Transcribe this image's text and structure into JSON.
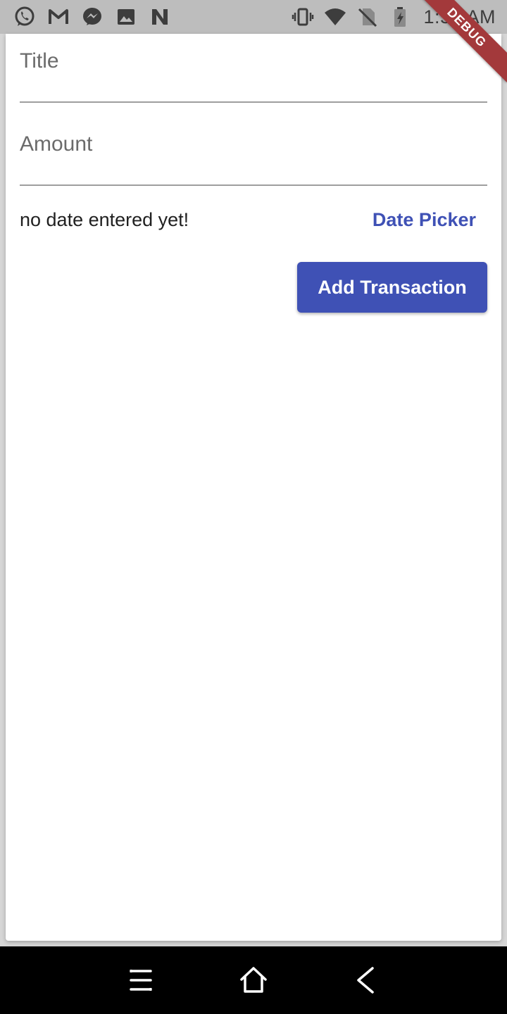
{
  "status_bar": {
    "time": "1:54 AM",
    "left_icons": [
      "whatsapp-icon",
      "gmail-icon",
      "messenger-icon",
      "gallery-icon",
      "app-n-icon"
    ],
    "right_icons": [
      "vibrate-icon",
      "wifi-icon",
      "no-sim-icon",
      "battery-icon"
    ]
  },
  "debug_banner": "DEBUG",
  "form": {
    "title_label": "Title",
    "title_value": "",
    "amount_label": "Amount",
    "amount_value": "",
    "date_text": "no date entered yet!",
    "date_picker_label": "Date Picker",
    "submit_label": "Add Transaction"
  },
  "colors": {
    "primary": "#3f51b5",
    "debug": "#a3393b"
  },
  "nav_bar": {
    "buttons": [
      "menu-icon",
      "home-icon",
      "back-icon"
    ]
  }
}
